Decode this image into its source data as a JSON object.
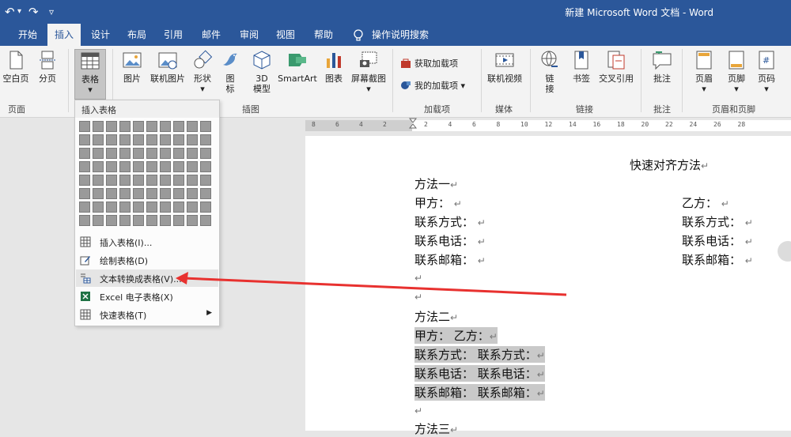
{
  "quick_access": {
    "undo": "↶",
    "redo": "↷",
    "more": "▿"
  },
  "window": {
    "title": "新建 Microsoft Word 文档 - Word"
  },
  "tabs": [
    "开始",
    "插入",
    "设计",
    "布局",
    "引用",
    "邮件",
    "审阅",
    "视图",
    "帮助"
  ],
  "tell_me": "操作说明搜索",
  "ribbon": {
    "pages": {
      "blank": "空白页",
      "break": "分页",
      "group": "页面"
    },
    "table": {
      "label": "表格",
      "group": "表格"
    },
    "illustrations": {
      "picture": "图片",
      "online_picture": "联机图片",
      "shapes": "形状",
      "icons_1": "图",
      "icons_2": "标",
      "model_1": "3D",
      "model_2": "模型",
      "smartart": "SmartArt",
      "chart": "图表",
      "screenshot": "屏幕截图",
      "group": "插图"
    },
    "addins": {
      "get": "获取加载项",
      "my": "我的加载项",
      "group": "加载项"
    },
    "media": {
      "video": "联机视频",
      "group": "媒体"
    },
    "links": {
      "link_1": "链",
      "link_2": "接",
      "bookmark": "书签",
      "crossref": "交叉引用",
      "group": "链接"
    },
    "comments": {
      "comment": "批注",
      "group": "批注"
    },
    "header_footer": {
      "header": "页眉",
      "footer": "页脚",
      "page_number": "页码",
      "group": "页眉和页脚"
    }
  },
  "menu": {
    "header": "插入表格",
    "items": [
      {
        "label": "插入表格(I)..."
      },
      {
        "label": "绘制表格(D)"
      },
      {
        "label": "文本转换成表格(V)..."
      },
      {
        "label": "Excel 电子表格(X)"
      },
      {
        "label": "快速表格(T)"
      }
    ]
  },
  "ruler": {
    "ticks": [
      "8",
      "6",
      "4",
      "2",
      "2",
      "4",
      "6",
      "8",
      "10",
      "12",
      "14",
      "16",
      "18",
      "20",
      "22",
      "24",
      "26",
      "28"
    ]
  },
  "document": {
    "title": "快速对齐方法",
    "m1": "方法一",
    "p1_left": [
      "甲方：",
      "联系方式：",
      "联系电话：",
      "联系邮箱："
    ],
    "p1_right": [
      "乙方：",
      "联系方式：",
      "联系电话：",
      "联系邮箱："
    ],
    "m2": "方法二",
    "p2": [
      "甲方：  乙方：",
      "联系方式：  联系方式：",
      "联系电话：  联系电话：",
      "联系邮箱：  联系邮箱："
    ],
    "m3": "方法三",
    "para_mark": "↵"
  },
  "colors": {
    "brand": "#2b579a",
    "arrow": "#e8312f"
  }
}
